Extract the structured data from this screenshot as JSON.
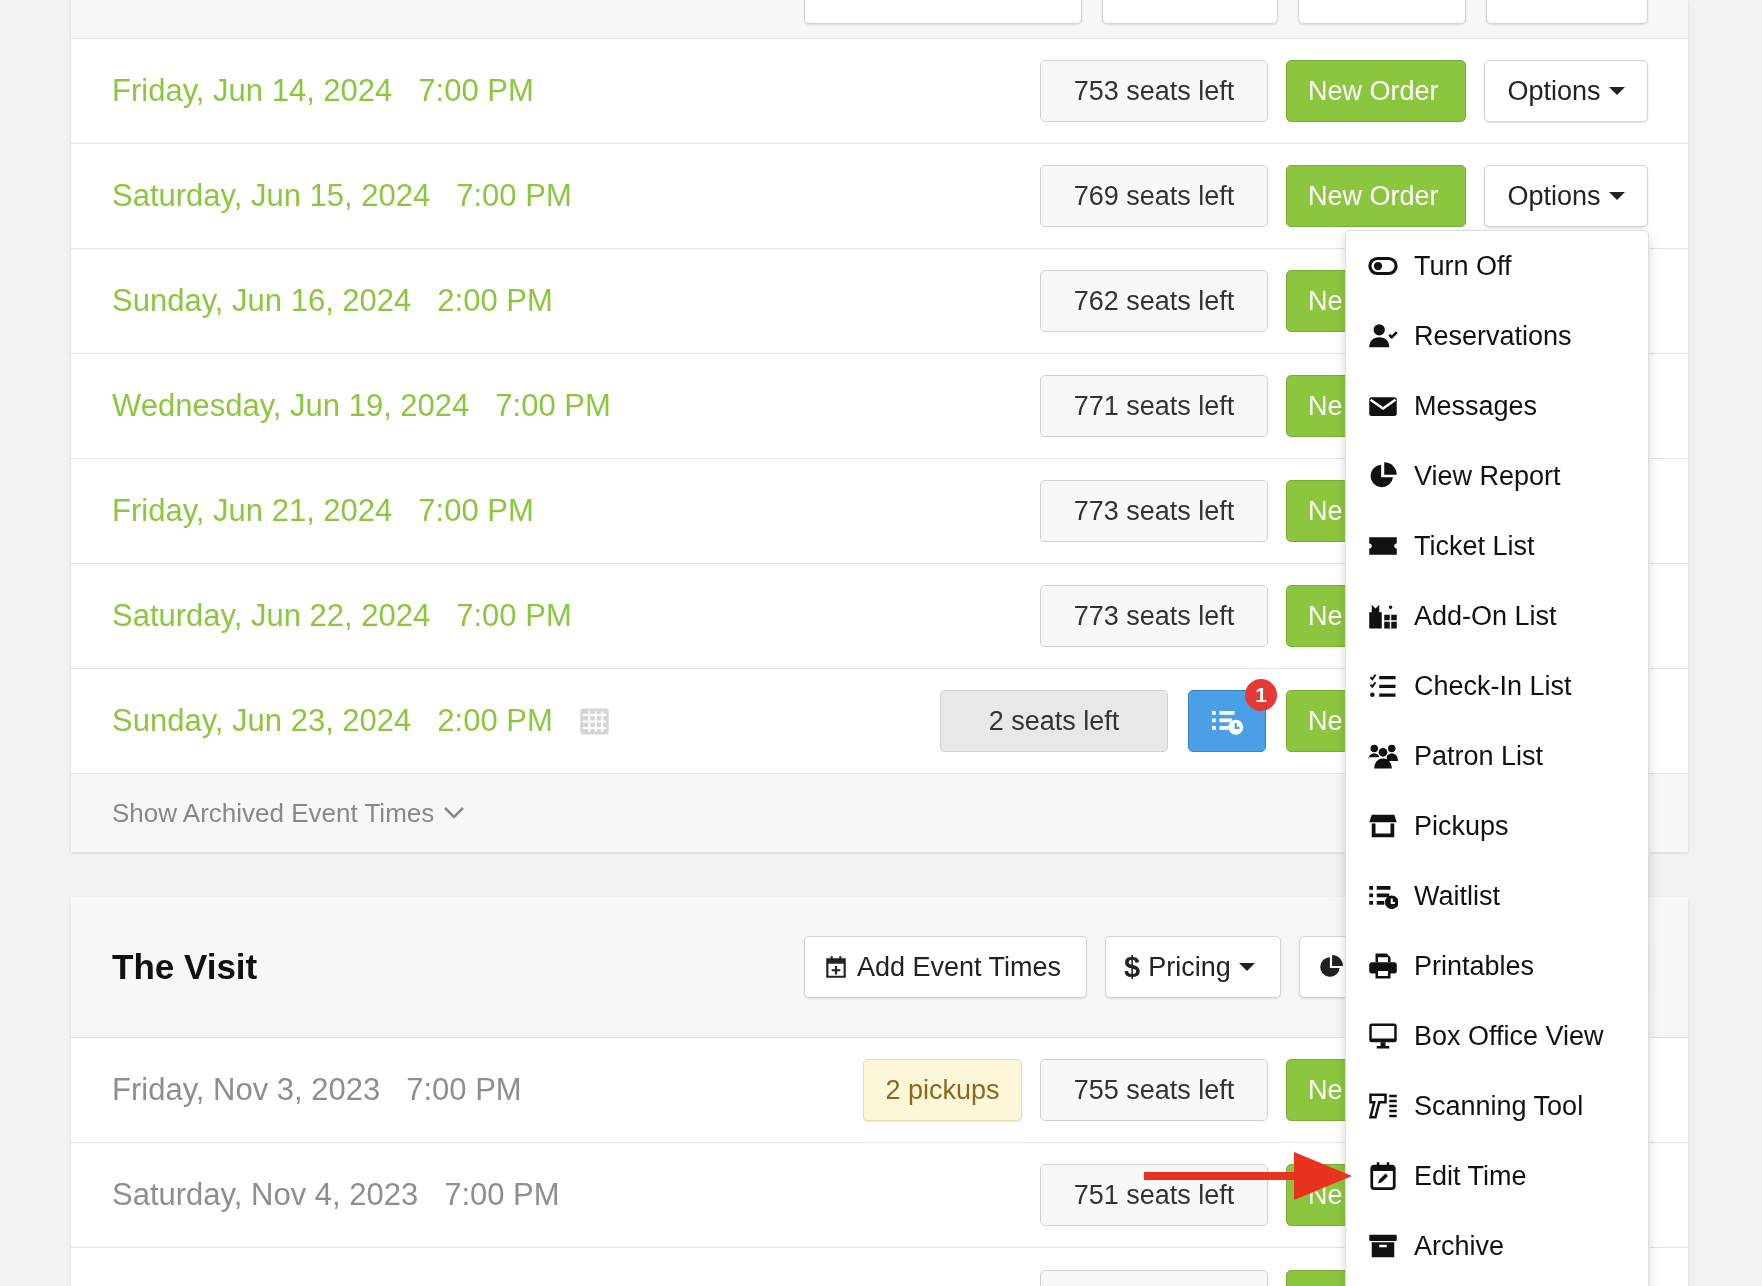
{
  "sections": [
    {
      "kind": "cut_top",
      "events": [
        {
          "kind": "full",
          "date": "Friday, Jun 14, 2024",
          "time": "7:00 PM",
          "past": false,
          "seats": "753 seats left",
          "low": false,
          "order_button": "New Order",
          "options_button": "Options"
        },
        {
          "kind": "full",
          "date": "Saturday, Jun 15, 2024",
          "time": "7:00 PM",
          "past": false,
          "seats": "769 seats left",
          "low": false,
          "order_button": "New Order",
          "options_button": "Options"
        },
        {
          "kind": "full",
          "date": "Sunday, Jun 16, 2024",
          "time": "2:00 PM",
          "past": false,
          "seats": "762 seats left",
          "low": false,
          "order_button": "Ne"
        },
        {
          "kind": "full",
          "date": "Wednesday, Jun 19, 2024",
          "time": "7:00 PM",
          "past": false,
          "seats": "771 seats left",
          "low": false,
          "order_button": "Ne"
        },
        {
          "kind": "full",
          "date": "Friday, Jun 21, 2024",
          "time": "7:00 PM",
          "past": false,
          "seats": "773 seats left",
          "low": false,
          "order_button": "Ne"
        },
        {
          "kind": "full",
          "date": "Saturday, Jun 22, 2024",
          "time": "7:00 PM",
          "past": false,
          "seats": "773 seats left",
          "low": false,
          "order_button": "Ne"
        },
        {
          "kind": "full",
          "date": "Sunday, Jun 23, 2024",
          "time": "2:00 PM",
          "past": false,
          "seating_chart": true,
          "seats": "2 seats left",
          "low": true,
          "waitlist_badge": "1",
          "order_button": "Ne"
        }
      ],
      "archived_toggle": "Show Archived Event Times"
    },
    {
      "kind": "titled",
      "title": "The Visit",
      "header_buttons": [
        {
          "kind": "add",
          "label": "Add Event Times"
        },
        {
          "kind": "pricing",
          "symbol": "$",
          "label": "Pricing"
        },
        {
          "kind": "report"
        }
      ],
      "events": [
        {
          "kind": "full",
          "date": "Friday, Nov 3, 2023",
          "time": "7:00 PM",
          "past": true,
          "pickups": "2 pickups",
          "seats": "755 seats left",
          "low": false,
          "order_button": "Ne"
        },
        {
          "kind": "full",
          "date": "Saturday, Nov 4, 2023",
          "time": "7:00 PM",
          "past": true,
          "seats": "751 seats left",
          "low": false,
          "order_button": "Ne"
        },
        {
          "kind": "partial"
        }
      ]
    }
  ],
  "options_menu": {
    "items": [
      {
        "kind": "toggle",
        "label": "Turn Off"
      },
      {
        "kind": "user-check",
        "label": "Reservations"
      },
      {
        "kind": "envelope",
        "label": "Messages"
      },
      {
        "kind": "pie",
        "label": "View Report"
      },
      {
        "kind": "ticket",
        "label": "Ticket List"
      },
      {
        "kind": "gift",
        "label": "Add-On List"
      },
      {
        "kind": "checklist",
        "label": "Check-In List"
      },
      {
        "kind": "users",
        "label": "Patron List"
      },
      {
        "kind": "store",
        "label": "Pickups"
      },
      {
        "kind": "waitlist",
        "label": "Waitlist"
      },
      {
        "kind": "printer",
        "label": "Printables"
      },
      {
        "kind": "monitor",
        "label": "Box Office View"
      },
      {
        "kind": "scanner",
        "label": "Scanning Tool"
      },
      {
        "kind": "calendar-edit",
        "label": "Edit Time"
      },
      {
        "kind": "archive",
        "label": "Archive"
      }
    ]
  }
}
